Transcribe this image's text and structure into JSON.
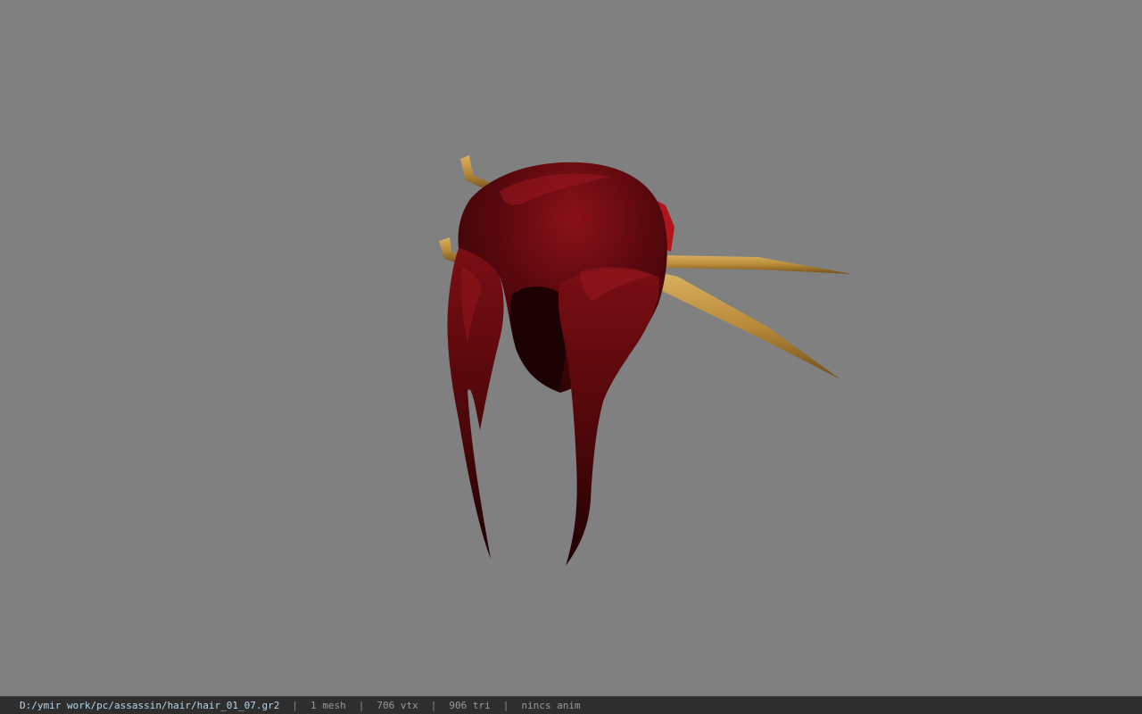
{
  "viewport": {
    "background_color": "#808080",
    "model": {
      "hair_color": "#6a0a10",
      "hair_dark_color": "#250204",
      "hairpin_color": "#b88a3a"
    }
  },
  "status_bar": {
    "file_path": "D:/ymir work/pc/assassin/hair/hair_01_07.gr2",
    "separator": "|",
    "mesh_count": "1 mesh",
    "vertex_count": "706 vtx",
    "triangle_count": "906 tri",
    "animation": "nincs anim"
  }
}
